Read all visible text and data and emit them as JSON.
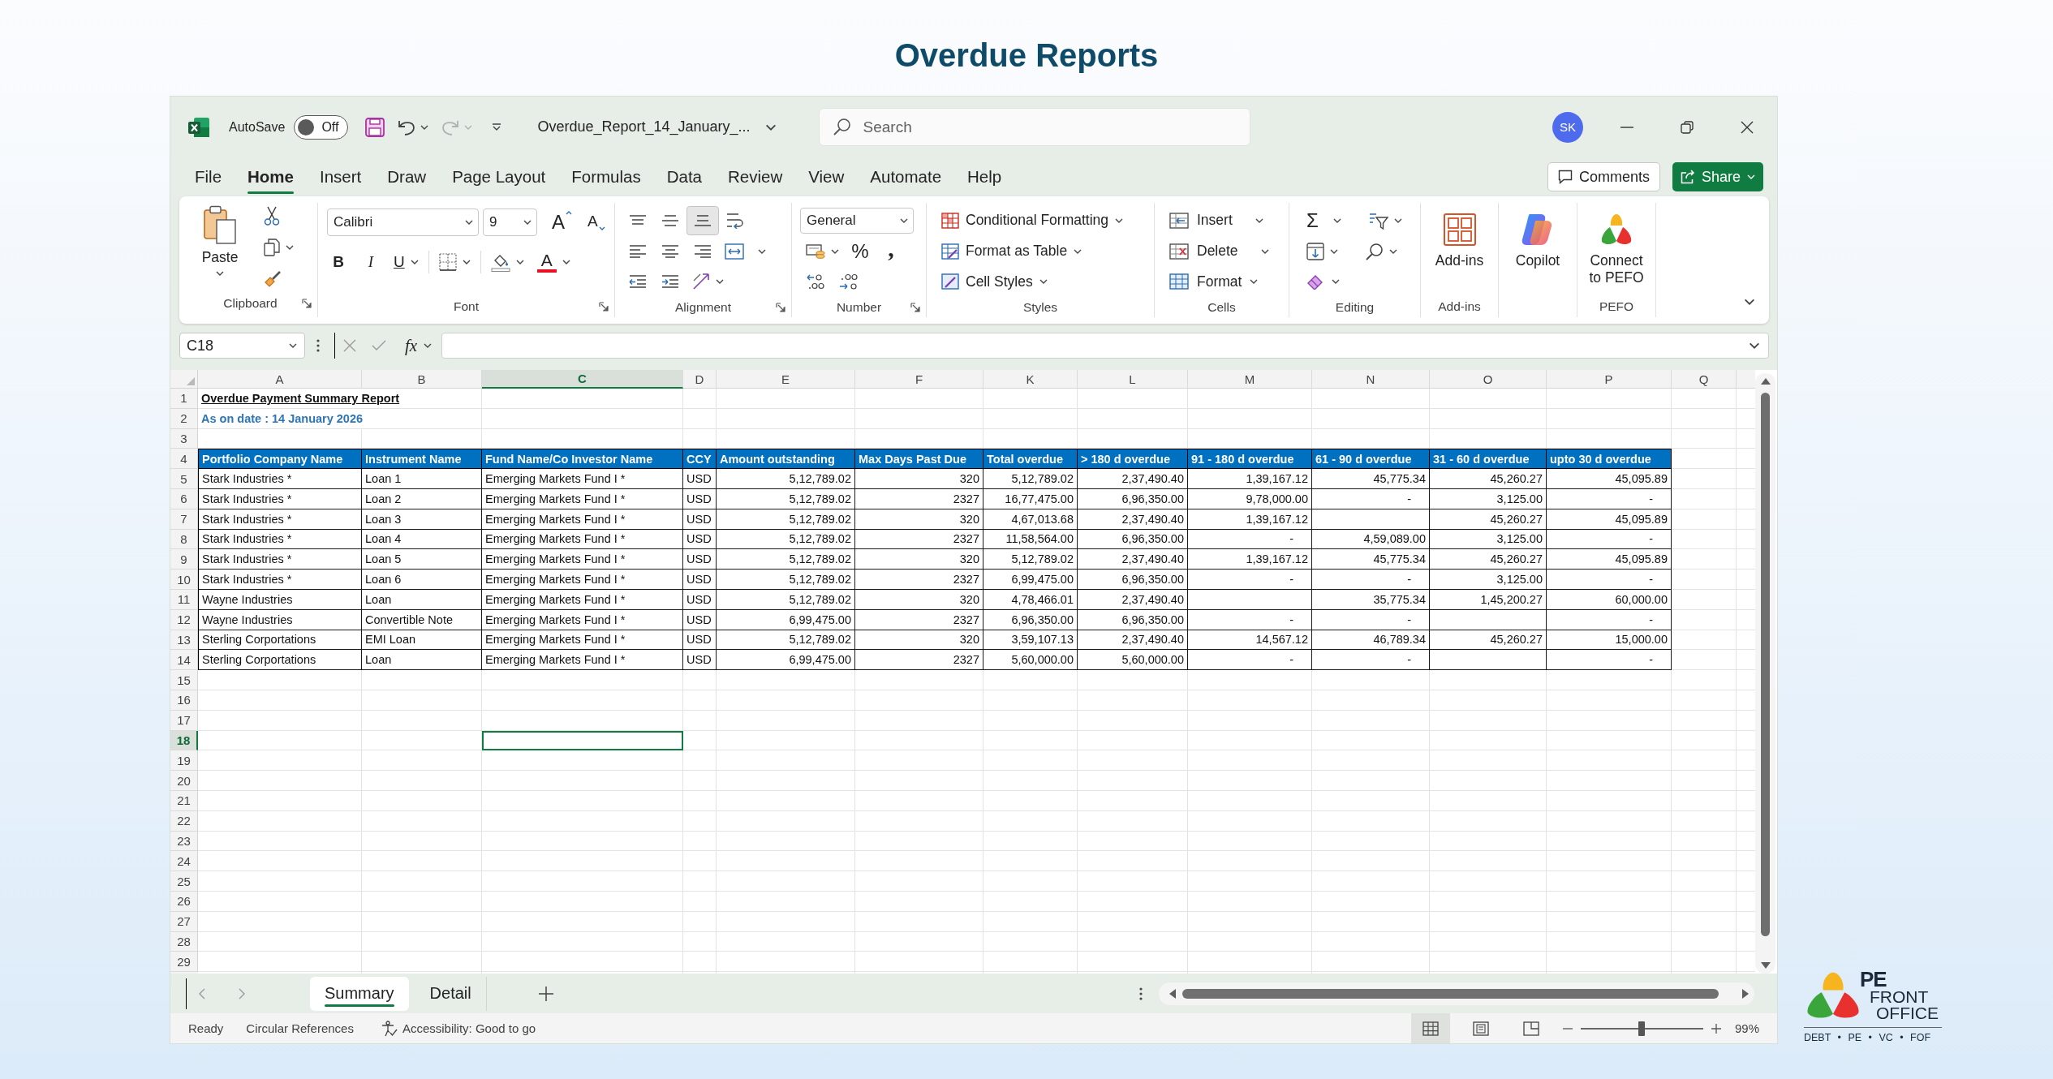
{
  "page": {
    "title": "Overdue Reports"
  },
  "title_bar": {
    "autosave_label": "AutoSave",
    "autosave": {
      "on": false,
      "label": "Off"
    },
    "quick_access": [
      {
        "kind": "save",
        "disabled": false
      },
      {
        "kind": "undo",
        "disabled": false
      },
      {
        "kind": "redo",
        "disabled": true
      }
    ],
    "file_name": "Overdue_Report_14_January_...",
    "search": {
      "placeholder": "Search"
    },
    "avatar": "SK"
  },
  "menu": {
    "tabs": [
      {
        "label": "File",
        "selected": false
      },
      {
        "label": "Home",
        "selected": true
      },
      {
        "label": "Insert",
        "selected": false
      },
      {
        "label": "Draw",
        "selected": false
      },
      {
        "label": "Page Layout",
        "selected": false
      },
      {
        "label": "Formulas",
        "selected": false
      },
      {
        "label": "Data",
        "selected": false
      },
      {
        "label": "Review",
        "selected": false
      },
      {
        "label": "View",
        "selected": false
      },
      {
        "label": "Automate",
        "selected": false
      },
      {
        "label": "Help",
        "selected": false
      }
    ],
    "comments_button": "Comments",
    "share_button": "Share"
  },
  "ribbon": {
    "clipboard": {
      "label": "Clipboard",
      "paste": "Paste"
    },
    "font": {
      "label": "Font",
      "font_name": "Calibri",
      "font_size": "9",
      "grow_font": "A",
      "shrink_font": "A",
      "bold": "B",
      "italic": "I",
      "underline": "U",
      "font_color": "A"
    },
    "alignment": {
      "label": "Alignment",
      "vertical": [
        {
          "kind": "top",
          "selected": false
        },
        {
          "kind": "middle",
          "selected": false
        },
        {
          "kind": "bottom",
          "selected": true
        }
      ]
    },
    "number": {
      "label": "Number",
      "format": "General",
      "percent": "%",
      "comma": ","
    },
    "styles": {
      "label": "Styles",
      "items": [
        "Conditional Formatting",
        "Format as Table",
        "Cell Styles"
      ]
    },
    "cells": {
      "label": "Cells",
      "items": [
        "Insert",
        "Delete",
        "Format"
      ]
    },
    "editing": {
      "label": "Editing",
      "sum": "Σ"
    },
    "add_ins": {
      "label": "Add-ins",
      "button": "Add-ins"
    },
    "copilot": {
      "button": "Copilot"
    },
    "pefo": {
      "label": "PEFO",
      "button": "Connect to PEFO"
    }
  },
  "formula_bar": {
    "name_box": "C18",
    "function_label": "fx"
  },
  "sheet": {
    "columns": [
      {
        "label": "A",
        "selected": false
      },
      {
        "label": "B",
        "selected": false
      },
      {
        "label": "C",
        "selected": true
      },
      {
        "label": "D",
        "selected": false
      },
      {
        "label": "E",
        "selected": false
      },
      {
        "label": "F",
        "selected": false
      },
      {
        "label": "K",
        "selected": false
      },
      {
        "label": "L",
        "selected": false
      },
      {
        "label": "M",
        "selected": false
      },
      {
        "label": "N",
        "selected": false
      },
      {
        "label": "O",
        "selected": false
      },
      {
        "label": "P",
        "selected": false
      },
      {
        "label": "Q",
        "selected": false
      }
    ],
    "rows": [
      {
        "number": "1",
        "selected": false
      },
      {
        "number": "2",
        "selected": false
      },
      {
        "number": "3",
        "selected": false
      },
      {
        "number": "4",
        "selected": false
      },
      {
        "number": "5",
        "selected": false
      },
      {
        "number": "6",
        "selected": false
      },
      {
        "number": "7",
        "selected": false
      },
      {
        "number": "8",
        "selected": false
      },
      {
        "number": "9",
        "selected": false
      },
      {
        "number": "10",
        "selected": false
      },
      {
        "number": "11",
        "selected": false
      },
      {
        "number": "12",
        "selected": false
      },
      {
        "number": "13",
        "selected": false
      },
      {
        "number": "14",
        "selected": false
      },
      {
        "number": "15",
        "selected": false
      },
      {
        "number": "16",
        "selected": false
      },
      {
        "number": "17",
        "selected": false
      },
      {
        "number": "18",
        "selected": true
      },
      {
        "number": "19",
        "selected": false
      },
      {
        "number": "20",
        "selected": false
      },
      {
        "number": "21",
        "selected": false
      },
      {
        "number": "22",
        "selected": false
      },
      {
        "number": "23",
        "selected": false
      },
      {
        "number": "24",
        "selected": false
      },
      {
        "number": "25",
        "selected": false
      },
      {
        "number": "26",
        "selected": false
      },
      {
        "number": "27",
        "selected": false
      },
      {
        "number": "28",
        "selected": false
      },
      {
        "number": "29",
        "selected": false
      }
    ],
    "report_title": "Overdue Payment Summary Report",
    "report_date": "As on date : 14 January 2026",
    "table": {
      "columns": [
        "Portfolio Company Name",
        "Instrument Name",
        "Fund Name/Co Investor Name",
        "CCY",
        "Amount outstanding",
        "Max Days Past Due",
        "Total overdue",
        "> 180 d overdue",
        "91 - 180 d overdue",
        "61 - 90 d overdue",
        "31 - 60 d overdue",
        "upto 30 d overdue"
      ],
      "rows": [
        [
          "Stark Industries *",
          "Loan 1",
          "Emerging Markets Fund I *",
          "USD",
          "5,12,789.02",
          "320",
          "5,12,789.02",
          "2,37,490.40",
          "1,39,167.12",
          "45,775.34",
          "45,260.27",
          "45,095.89"
        ],
        [
          "Stark Industries *",
          "Loan 2",
          "Emerging Markets Fund I *",
          "USD",
          "5,12,789.02",
          "2327",
          "16,77,475.00",
          "6,96,350.00",
          "9,78,000.00",
          "-",
          "3,125.00",
          "-"
        ],
        [
          "Stark Industries *",
          "Loan 3",
          "Emerging Markets Fund I *",
          "USD",
          "5,12,789.02",
          "320",
          "4,67,013.68",
          "2,37,490.40",
          "1,39,167.12",
          null,
          "45,260.27",
          "45,095.89"
        ],
        [
          "Stark Industries *",
          "Loan 4",
          "Emerging Markets Fund I *",
          "USD",
          "5,12,789.02",
          "2327",
          "11,58,564.00",
          "6,96,350.00",
          "-",
          "4,59,089.00",
          "3,125.00",
          "-"
        ],
        [
          "Stark Industries *",
          "Loan 5",
          "Emerging Markets Fund I *",
          "USD",
          "5,12,789.02",
          "320",
          "5,12,789.02",
          "2,37,490.40",
          "1,39,167.12",
          "45,775.34",
          "45,260.27",
          "45,095.89"
        ],
        [
          "Stark Industries *",
          "Loan 6",
          "Emerging Markets Fund I *",
          "USD",
          "5,12,789.02",
          "2327",
          "6,99,475.00",
          "6,96,350.00",
          "-",
          "-",
          "3,125.00",
          "-"
        ],
        [
          "Wayne Industries",
          "Loan",
          "Emerging Markets Fund I *",
          "USD",
          "5,12,789.02",
          "320",
          "4,78,466.01",
          "2,37,490.40",
          null,
          "35,775.34",
          "1,45,200.27",
          "60,000.00"
        ],
        [
          "Wayne Industries",
          "Convertible Note",
          "Emerging Markets Fund I *",
          "USD",
          "6,99,475.00",
          "2327",
          "6,96,350.00",
          "6,96,350.00",
          "-",
          "-",
          null,
          "-"
        ],
        [
          "Sterling Corportations",
          "EMI Loan",
          "Emerging Markets Fund I *",
          "USD",
          "5,12,789.02",
          "320",
          "3,59,107.13",
          "2,37,490.40",
          "14,567.12",
          "46,789.34",
          "45,260.27",
          "15,000.00"
        ],
        [
          "Sterling Corportations",
          "Loan",
          "Emerging Markets Fund I *",
          "USD",
          "6,99,475.00",
          "2327",
          "5,60,000.00",
          "5,60,000.00",
          "-",
          "-",
          null,
          "-"
        ]
      ]
    }
  },
  "sheet_tabs": [
    {
      "label": "Summary",
      "selected": true
    },
    {
      "label": "Detail",
      "selected": false
    }
  ],
  "status_bar": {
    "ready": "Ready",
    "circular_references": "Circular References",
    "accessibility": "Accessibility: Good to go",
    "views": [
      {
        "kind": "normal",
        "selected": true
      },
      {
        "kind": "page_layout",
        "selected": false
      },
      {
        "kind": "page_break",
        "selected": false
      }
    ],
    "zoom": {
      "level": 0.5,
      "reading": "99%"
    }
  },
  "brand_logo": {
    "lines": [
      "PE",
      "FRONT",
      "OFFICE"
    ],
    "tagline": "DEBT • PE • VC • FOF"
  }
}
